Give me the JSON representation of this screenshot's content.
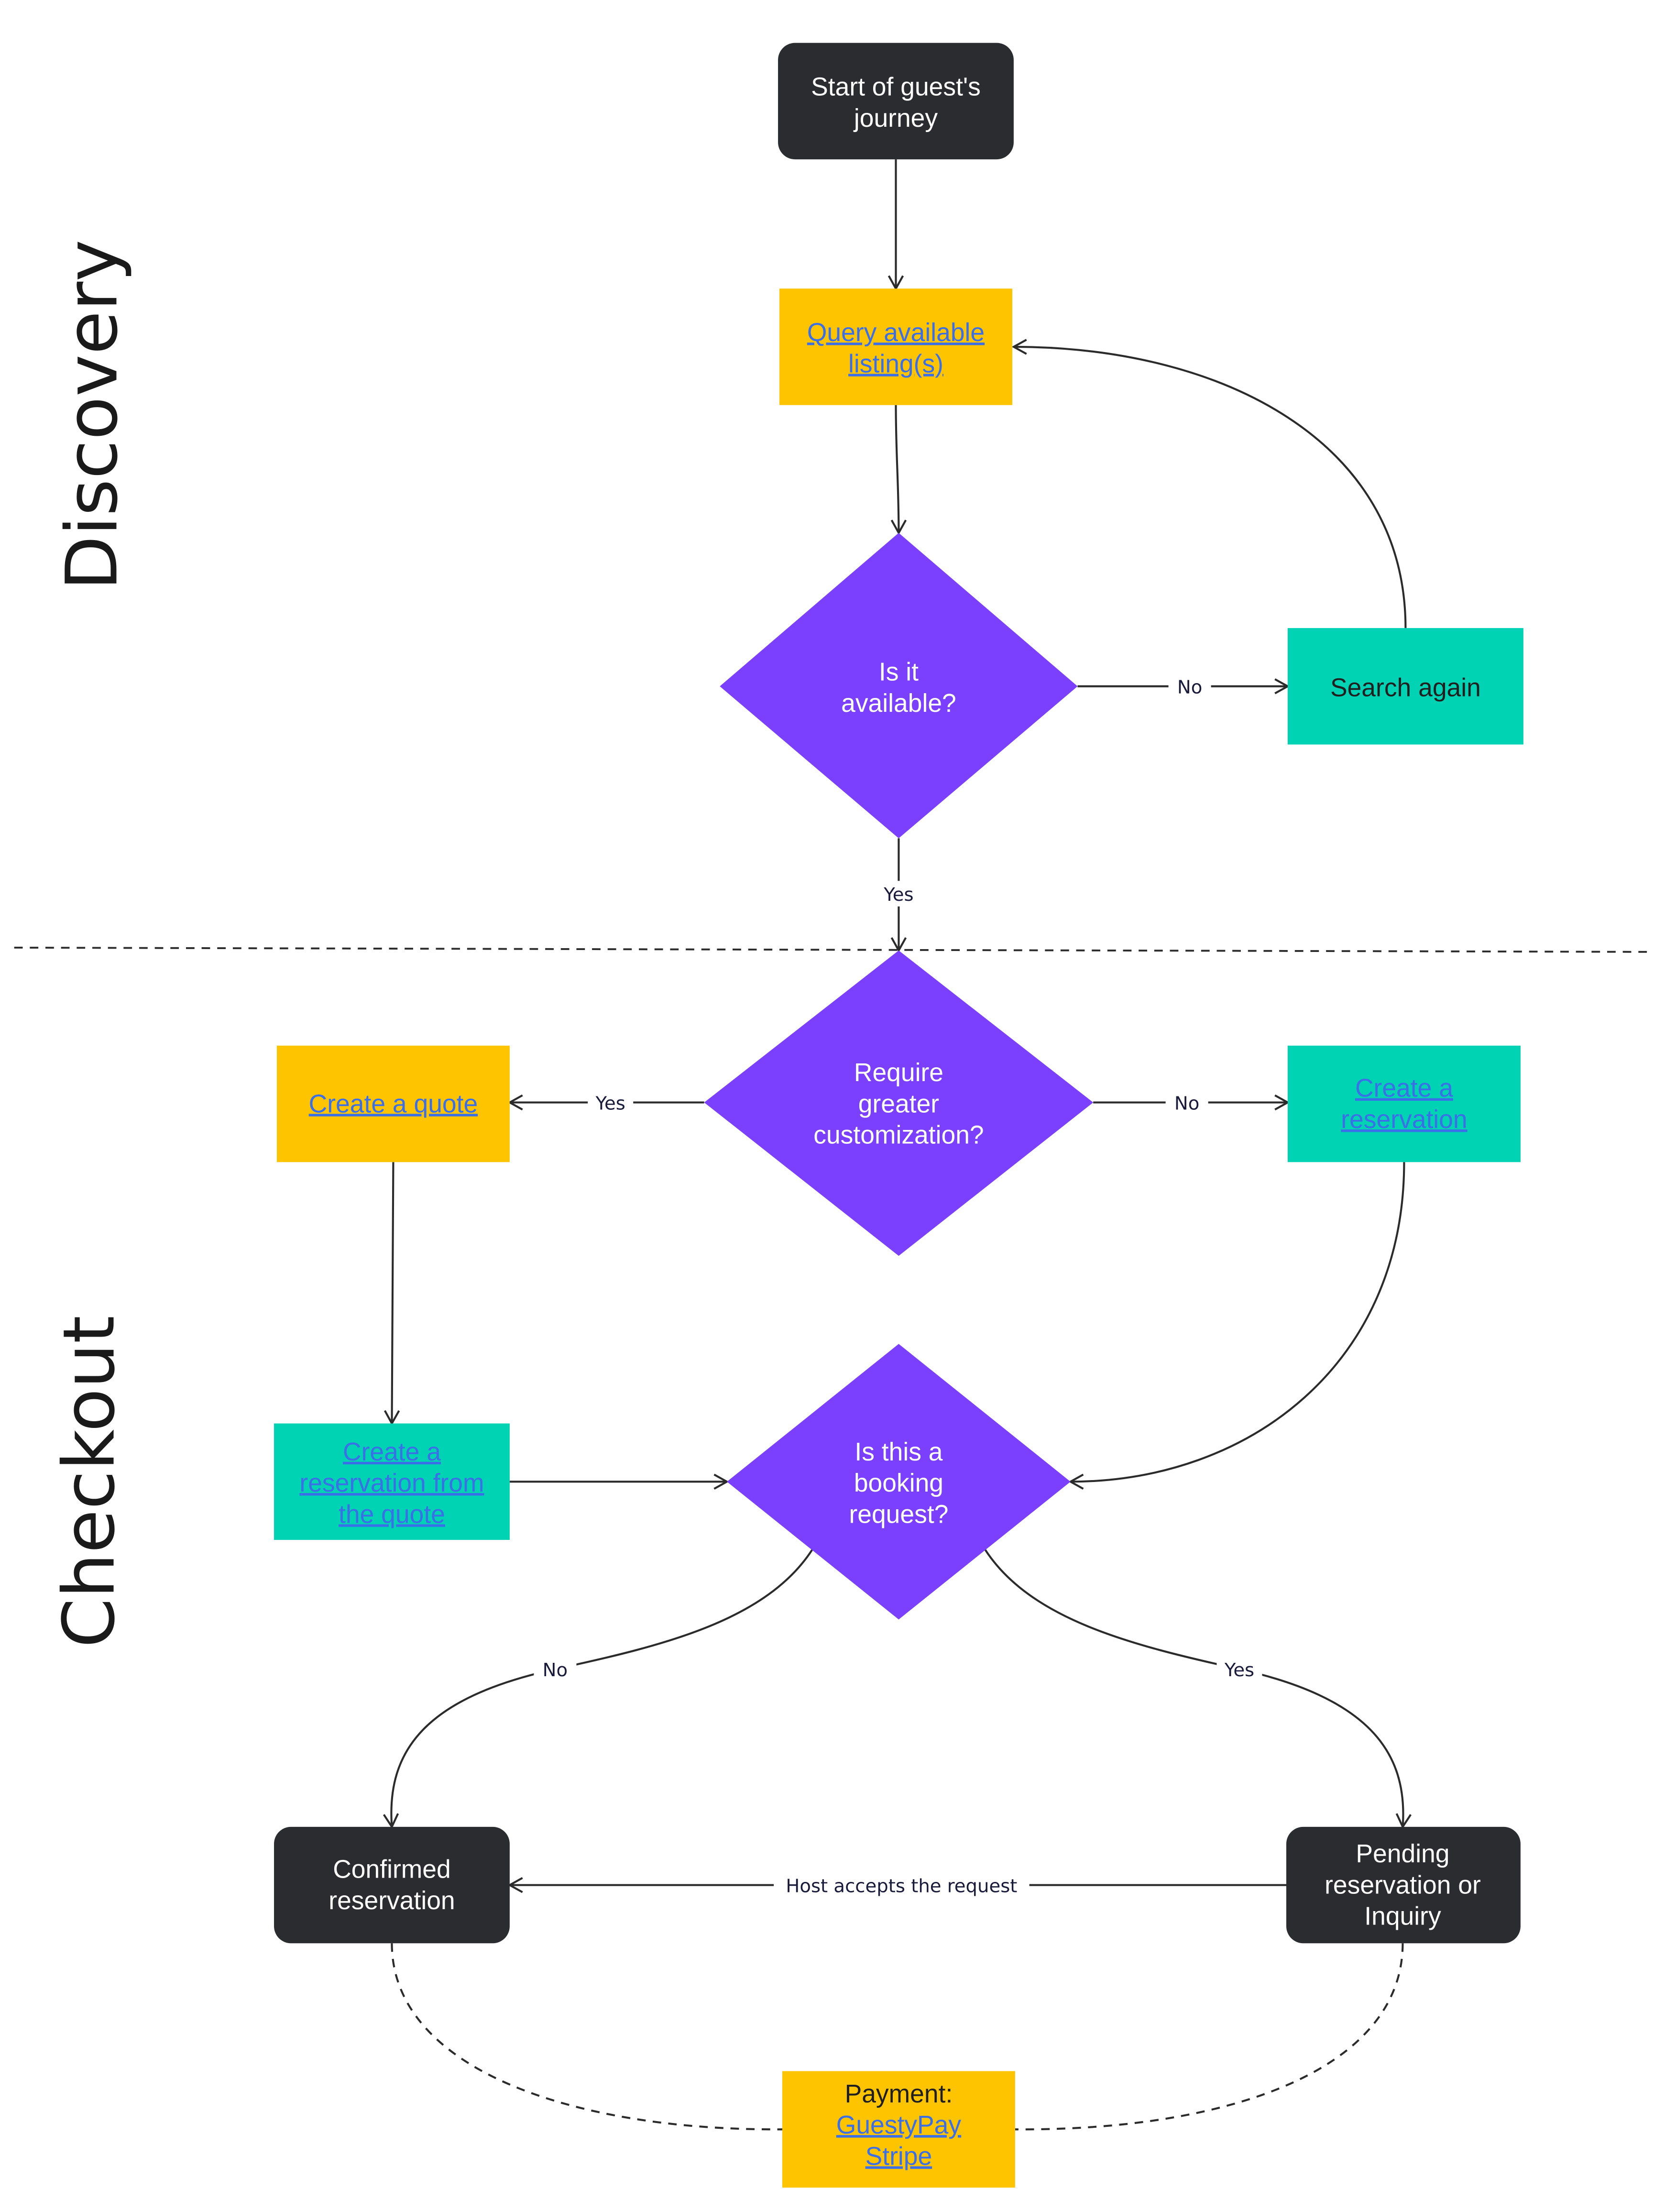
{
  "sections": {
    "discovery": "Discovery",
    "checkout": "Checkout"
  },
  "colors": {
    "dark": "#2b2c30",
    "yellow": "#ffc400",
    "purple": "#7b3ffe",
    "teal": "#00d2b4",
    "link": "#3b6fe8"
  },
  "nodes": {
    "start": [
      "Start of guest's",
      "journey"
    ],
    "query": [
      "Query available",
      "listing(s)"
    ],
    "is_available": [
      "Is it",
      "available?"
    ],
    "search_again": [
      "Search again"
    ],
    "require_custom": [
      "Require",
      "greater",
      "customization?"
    ],
    "create_quote": [
      "Create a quote"
    ],
    "create_reservation": [
      "Create a",
      "reservation"
    ],
    "is_booking_request": [
      "Is this a",
      "booking",
      "request?"
    ],
    "reservation_from_quote": [
      "Create a",
      "reservation from",
      "the quote"
    ],
    "confirmed": [
      "Confirmed",
      "reservation"
    ],
    "pending": [
      "Pending",
      "reservation or",
      "Inquiry"
    ],
    "payment": {
      "title": "Payment:",
      "links": [
        "GuestyPay",
        "Stripe"
      ]
    }
  },
  "edge_labels": {
    "not_available": "No",
    "available": "Yes",
    "custom_yes": "Yes",
    "custom_no": "No",
    "booking_no": "No",
    "booking_yes": "Yes",
    "host_accepts": "Host accepts the request"
  }
}
